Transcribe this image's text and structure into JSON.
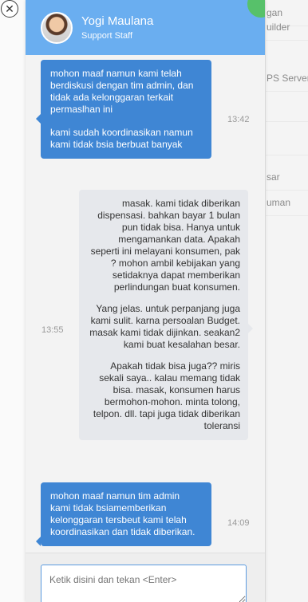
{
  "background": {
    "menu_items": [
      "gan",
      "uilder",
      "PS Server",
      "",
      "",
      "sar",
      "uman"
    ]
  },
  "chat": {
    "agent": {
      "name": "Yogi Maulana",
      "role": "Support Staff"
    },
    "messages": [
      {
        "from": "agent",
        "time": "13:42",
        "paragraphs": [
          "mohon maaf namun kami telah berdiskusi dengan tim admin, dan tidak ada kelonggaran terkait permaslhan ini",
          "kami sudah koordinasikan namun kami tidak bsia berbuat banyak"
        ]
      },
      {
        "from": "user",
        "time": "13:55",
        "paragraphs": [
          "masak. kami tidak diberikan dispensasi. bahkan bayar 1 bulan pun tidak bisa. Hanya untuk mengamankan data. Apakah seperti ini melayani konsumen, pak ? mohon ambil kebijakan yang setidaknya dapat memberikan perlindungan buat konsumen.",
          "Yang jelas. untuk perpanjang juga kami sulit. karna persoalan Budget. masak kami tidak dijinkan. seakan2 kami buat kesalahan besar.",
          "Apakah tidak bisa juga?? miris sekali saya.. kalau memang tidak bisa. masak, konsumen harus bermohon-mohon. minta tolong, telpon. dll. tapi juga tidak diberikan toleransi"
        ]
      },
      {
        "from": "agent",
        "time": "14:09",
        "paragraphs": [
          "mohon maaf namun tim admin kami tidak bsiamemberikan kelonggaran tersbeut kami telah koordinasikan dan tidak diberikan."
        ]
      }
    ],
    "composer": {
      "placeholder": "Ketik disini dan tekan <Enter>"
    }
  },
  "icons": {
    "close": "close-icon"
  }
}
